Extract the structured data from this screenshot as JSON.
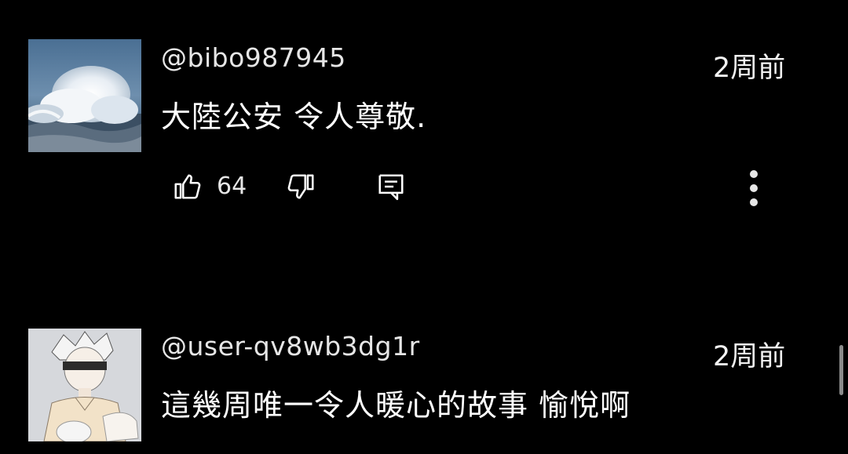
{
  "comments": [
    {
      "username": "@bibo987945",
      "time": "2周前",
      "text": "大陸公安 令人尊敬.",
      "likes": "64",
      "avatar_desc": "ocean-wave",
      "icons": {
        "like": "thumbs-up-icon",
        "dislike": "thumbs-down-icon",
        "reply": "reply-icon",
        "more": "more-vert-icon"
      }
    },
    {
      "username": "@user-qv8wb3dg1r",
      "time": "2周前",
      "text": "這幾周唯一令人暖心的故事 愉悅啊",
      "avatar_desc": "anime-character"
    }
  ],
  "colors": {
    "background": "#000000",
    "text": "#ffffff",
    "secondary_text": "#e6e6e6",
    "scrollbar": "#8a8a8a"
  }
}
